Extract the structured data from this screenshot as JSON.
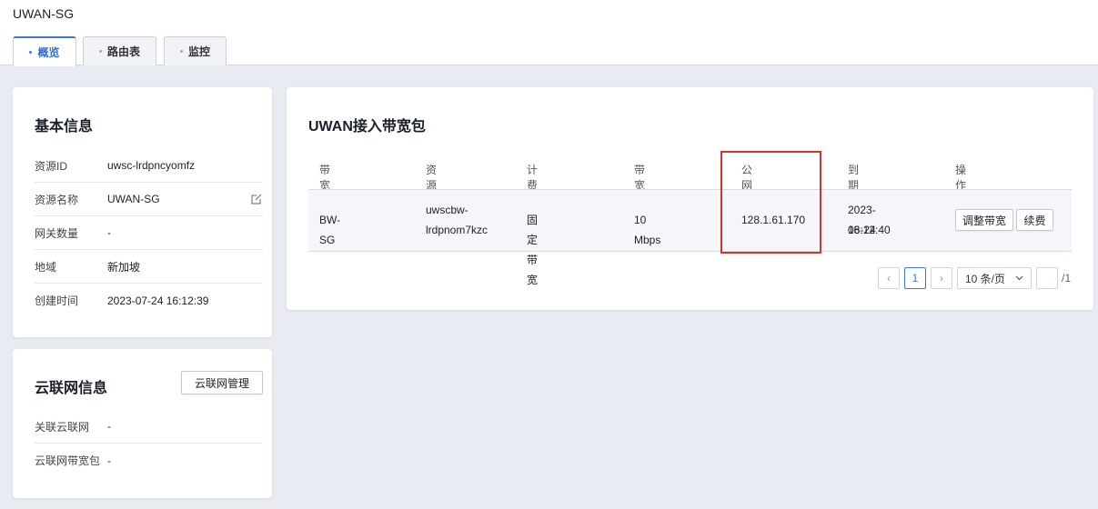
{
  "page": {
    "title": "UWAN-SG"
  },
  "tabs": [
    {
      "label": "概览",
      "active": true
    },
    {
      "label": "路由表",
      "active": false
    },
    {
      "label": "监控",
      "active": false
    }
  ],
  "basic_info": {
    "title": "基本信息",
    "rows": [
      {
        "label": "资源ID",
        "value": "uwsc-lrdpncyomfz"
      },
      {
        "label": "资源名称",
        "value": "UWAN-SG"
      },
      {
        "label": "网关数量",
        "value": "-"
      },
      {
        "label": "地域",
        "value": "新加坡"
      },
      {
        "label": "创建时间",
        "value": "2023-07-24 16:12:39"
      }
    ]
  },
  "cloud_net": {
    "title": "云联网信息",
    "manage_button": "云联网管理",
    "rows": [
      {
        "label": "关联云联网",
        "value": "-"
      },
      {
        "label": "云联网带宽包",
        "value": "-"
      }
    ]
  },
  "bandwidth": {
    "title": "UWAN接入带宽包",
    "columns": [
      "带宽包名称",
      "资源ID",
      "计费方式",
      "带宽",
      "公网IP",
      "到期时间",
      "操作"
    ],
    "row": {
      "name": "BW-SG",
      "id_line1": "uwscbw-",
      "id_line2": "lrdpnom7kzc",
      "billing": "固定带宽",
      "bandwidth": "10 Mbps",
      "ip": "128.1.61.170",
      "expire_date": "2023-08-24",
      "expire_time": "16:12:40",
      "action_adjust": "调整带宽",
      "action_renew": "续费"
    },
    "pagination": {
      "prev": "‹",
      "current": "1",
      "next": "›",
      "page_size": "10 条/页",
      "total": "/1"
    }
  },
  "colors": {
    "accent": "#3b76e1",
    "highlight": "#d9322b"
  }
}
